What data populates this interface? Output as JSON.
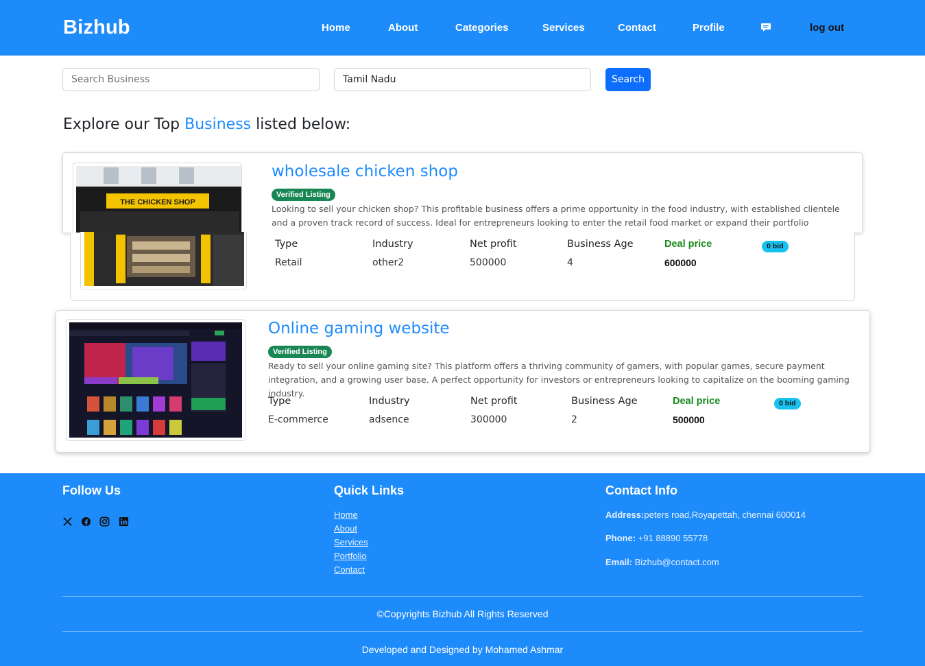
{
  "header": {
    "brand": "Bizhub",
    "nav": [
      "Home",
      "About",
      "Categories",
      "Services",
      "Contact",
      "Profile"
    ],
    "message_icon": "message-icon",
    "logout": "log out",
    "color": "#1e8bfb"
  },
  "search": {
    "business_placeholder": "Search Business",
    "location_value": "Tamil Nadu",
    "button": "Search"
  },
  "heading": {
    "prefix": "Explore our Top ",
    "highlight": "Business",
    "suffix": " listed below:"
  },
  "listings": [
    {
      "title": "wholesale chicken shop",
      "badge": "Verified Listing",
      "description": "Looking to sell your chicken shop? This profitable business offers a prime opportunity in the food industry, with established clientele and a proven track record of success. Ideal for entrepreneurs looking to enter the retail food market or expand their portfolio",
      "labels": {
        "type": "Type",
        "industry": "Industry",
        "net_profit": "Net profit",
        "age": "Business Age",
        "deal": "Deal price"
      },
      "type": "Retail",
      "industry": "other2",
      "net_profit": "500000",
      "age": "4",
      "deal_price": "600000",
      "bids": "0 bid",
      "image_sign": "THE CHICKEN SHOP"
    },
    {
      "title": "Online gaming website",
      "badge": "Verified Listing",
      "description": "Ready to sell your online gaming site? This platform offers a thriving community of gamers, with popular games, secure payment integration, and a growing user base. A perfect opportunity for investors or entrepreneurs looking to capitalize on the booming gaming industry.",
      "labels": {
        "type": "Type",
        "industry": "Industry",
        "net_profit": "Net profit",
        "age": "Business Age",
        "deal": "Deal price"
      },
      "type": "E-commerce",
      "industry": "adsence",
      "net_profit": "300000",
      "age": "2",
      "deal_price": "500000",
      "bids": "0 bid"
    }
  ],
  "footer": {
    "follow": {
      "heading": "Follow Us",
      "icons": [
        "x-icon",
        "facebook-icon",
        "instagram-icon",
        "linkedin-icon"
      ]
    },
    "quick_links": {
      "heading": "Quick Links",
      "links": [
        "Home",
        "About",
        "Services",
        "Portfolio",
        "Contact"
      ]
    },
    "contact": {
      "heading": "Contact Info",
      "address_label": "Address:",
      "address": "peters road,Royapettah, chennai 600014",
      "phone_label": "Phone:",
      "phone": " +91 88890 55778",
      "email_label": "Email:",
      "email": " Bizhub@contact.com"
    },
    "copyright": "©Copyrights Bizhub All Rights Reserved",
    "developer": "Developed and Designed by Mohamed Ashmar"
  },
  "colors": {
    "primary": "#1e8bfb",
    "button": "#0d6efd",
    "verified": "#198754",
    "deal": "#198a1c",
    "bid": "#18c2ef"
  }
}
